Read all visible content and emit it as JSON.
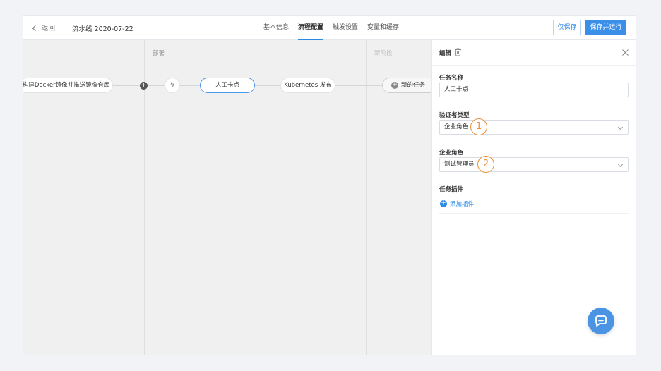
{
  "header": {
    "back_label": "返回",
    "pipeline_title": "流水线 2020-07-22",
    "tabs": [
      {
        "label": "基本信息",
        "active": false
      },
      {
        "label": "流程配置",
        "active": true
      },
      {
        "label": "触发设置",
        "active": false
      },
      {
        "label": "变量和缓存",
        "active": false
      }
    ],
    "save_only_label": "仅保存",
    "save_run_label": "保存并运行"
  },
  "canvas": {
    "stages": [
      {
        "label": "部署"
      },
      {
        "label": "新阶段"
      }
    ],
    "nodes": {
      "build": "构建Docker镜像并推送镜像仓库",
      "manual": "人工卡点",
      "k8s": "Kubernetes 发布",
      "new_task": "新的任务"
    },
    "plus_glyph": "+",
    "bolt_glyph": "ϟ"
  },
  "panel": {
    "title": "编辑",
    "fields": {
      "task_name_label": "任务名称",
      "task_name_value": "人工卡点",
      "verifier_type_label": "验证者类型",
      "verifier_type_value": "企业角色",
      "role_label": "企业角色",
      "role_value": "测试管理员",
      "plugins_label": "任务插件",
      "add_plugin_label": "添加插件"
    },
    "badges": [
      "1",
      "2"
    ]
  },
  "colors": {
    "accent": "#2b89e6",
    "badge": "#e8913a",
    "canvas_bg": "#f0f0f0"
  }
}
